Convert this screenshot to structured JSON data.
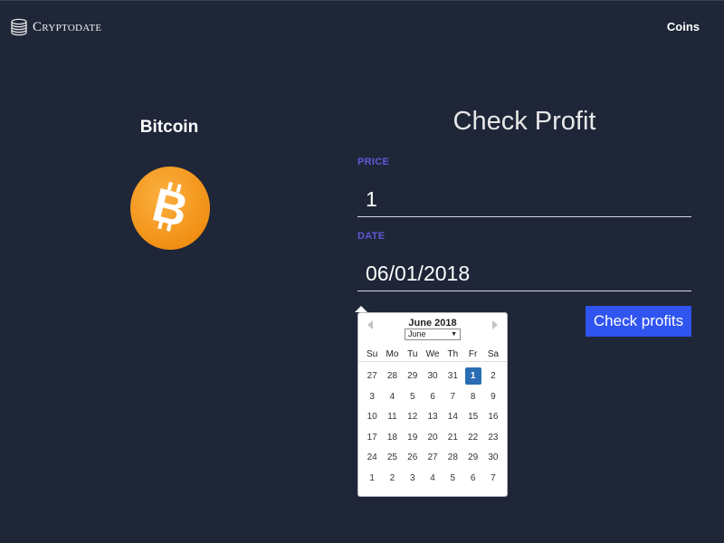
{
  "header": {
    "brand": "Cryptodate",
    "nav_coins": "Coins"
  },
  "coin": {
    "name": "Bitcoin",
    "logo_color": "#f7931a"
  },
  "form": {
    "title": "Check Profit",
    "price_label": "PRICE",
    "price_value": "1",
    "date_label": "DATE",
    "date_value": "06/01/2018",
    "submit_label": "Check profits",
    "accent_color": "#2f54f0",
    "label_color": "#5b5bd6"
  },
  "datepicker": {
    "title": "June 2018",
    "month_select": "June",
    "weekdays": [
      "Su",
      "Mo",
      "Tu",
      "We",
      "Th",
      "Fr",
      "Sa"
    ],
    "selected_day": "1",
    "weeks": [
      [
        "27",
        "28",
        "29",
        "30",
        "31",
        "1",
        "2"
      ],
      [
        "3",
        "4",
        "5",
        "6",
        "7",
        "8",
        "9"
      ],
      [
        "10",
        "11",
        "12",
        "13",
        "14",
        "15",
        "16"
      ],
      [
        "17",
        "18",
        "19",
        "20",
        "21",
        "22",
        "23"
      ],
      [
        "24",
        "25",
        "26",
        "27",
        "28",
        "29",
        "30"
      ],
      [
        "1",
        "2",
        "3",
        "4",
        "5",
        "6",
        "7"
      ]
    ]
  }
}
